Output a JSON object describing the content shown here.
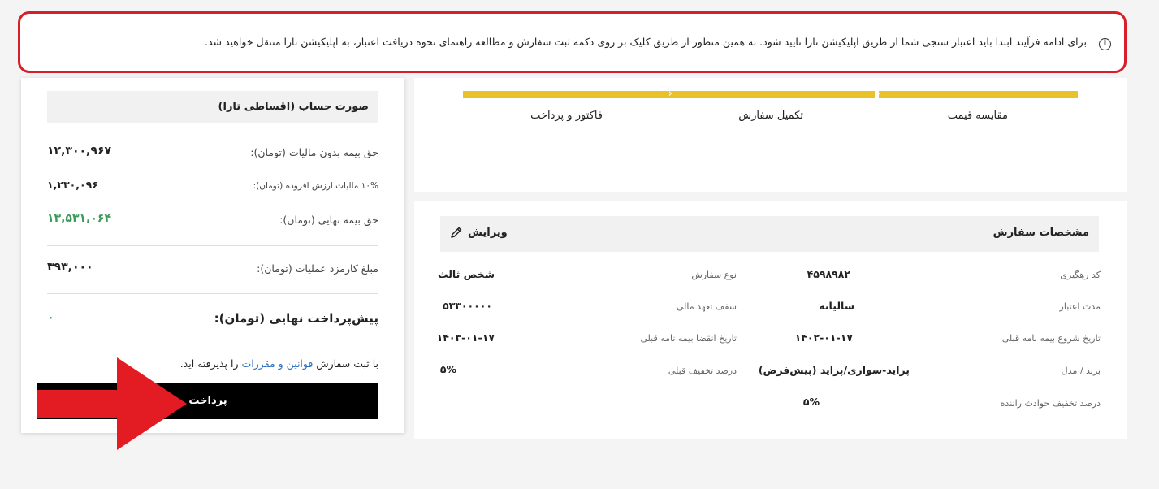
{
  "notice": {
    "text": "برای ادامه فرآیند ابتدا باید اعتبار سنجی شما از طریق اپلیکیشن تارا تایید شود. به همین منظور از طریق کلیک بر روی دکمه ثبت سفارش و مطالعه راهنمای نحوه دریافت اعتبار، به اپلیکیشن تارا منتقل خواهید شد.",
    "icon": "info-icon"
  },
  "steps": [
    {
      "label": "مقایسه قیمت"
    },
    {
      "label": "تکمیل سفارش"
    },
    {
      "label": "فاکتور و پرداخت"
    }
  ],
  "colors": {
    "progress": "#e9c22a",
    "alert_border": "#d61f2b",
    "green": "#3c9a5c",
    "link": "#2b6fbf",
    "arrow": "#e31c24"
  },
  "order": {
    "title": "مشخصات سفارش",
    "edit_label": "ویرایش",
    "right_rows": [
      {
        "label": "کد رهگیری",
        "value": "۴۵۹۸۹۸۲"
      },
      {
        "label": "مدت اعتبار",
        "value": "سالیانه"
      },
      {
        "label": "تاریخ شروع بیمه نامه قبلی",
        "value": "۱۴۰۲-۰۱-۱۷"
      },
      {
        "label": "برند / مدل",
        "value": "پراید-سواری/پراید (پیش‌فرض)"
      },
      {
        "label": "درصد تخفیف حوادث راننده",
        "value": "۵%"
      }
    ],
    "left_rows": [
      {
        "label": "نوع سفارش",
        "value": "شخص ثالث"
      },
      {
        "label": "سقف تعهد مالی",
        "value": "۵۳۳۰۰۰۰۰"
      },
      {
        "label": "تاریخ انقضا بیمه نامه قبلی",
        "value": "۱۴۰۳-۰۱-۱۷"
      },
      {
        "label": "درصد تخفیف قبلی",
        "value": "۵%"
      }
    ]
  },
  "invoice": {
    "title": "صورت حساب (اقساطی تارا)",
    "rows": [
      {
        "label": "حق بیمه بدون مالیات (تومان):",
        "value": "۱۲,۳۰۰,۹۶۷"
      },
      {
        "label": "۱۰% مالیات ارزش افزوده (تومان):",
        "value": "۱,۲۳۰,۰۹۶"
      },
      {
        "label": "حق بیمه نهایی (تومان):",
        "value": "۱۳,۵۳۱,۰۶۴"
      },
      {
        "label": "مبلغ کارمزد عملیات (تومان):",
        "value": "۳۹۳,۰۰۰"
      }
    ],
    "prepayment_label": "پیش‌پرداخت نهایی (تومان):",
    "prepayment_value": "۰",
    "terms_prefix": "با ثبت سفارش",
    "terms_link": "قوانین و مقررات",
    "terms_suffix": "را پذیرفته اید.",
    "pay_label": "پرداخت"
  }
}
